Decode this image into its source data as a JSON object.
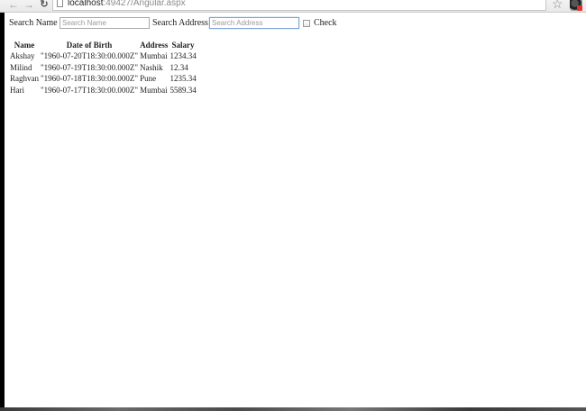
{
  "browser": {
    "url_host": "localhost",
    "url_path": ":49427/Angular.aspx",
    "back_icon": "back-arrow-icon",
    "forward_icon": "forward-arrow-icon",
    "reload_icon": "reload-icon",
    "star_icon": "bookmark-star-icon",
    "extension_icon": "extension-avatar-icon"
  },
  "search": {
    "name_label": "Search Name :",
    "name_placeholder": "Search Name",
    "name_value": "",
    "address_label": "Search Address :",
    "address_placeholder": "Search Address",
    "address_value": "",
    "check_label": "Check",
    "check_checked": false
  },
  "table": {
    "headers": [
      "Name",
      "Date of Birth",
      "Address",
      "Salary"
    ],
    "rows": [
      [
        "Akshay",
        "\"1960-07-20T18:30:00.000Z\"",
        "Mumbai",
        "1234.34"
      ],
      [
        "Milind",
        "\"1960-07-19T18:30:00.000Z\"",
        "Nashik",
        "12.34"
      ],
      [
        "Raghvan",
        "\"1960-07-18T18:30:00.000Z\"",
        "Pune",
        "1235.34"
      ],
      [
        "Hari",
        "\"1960-07-17T18:30:00.000Z\"",
        "Mumbai",
        "5589.34"
      ]
    ]
  }
}
